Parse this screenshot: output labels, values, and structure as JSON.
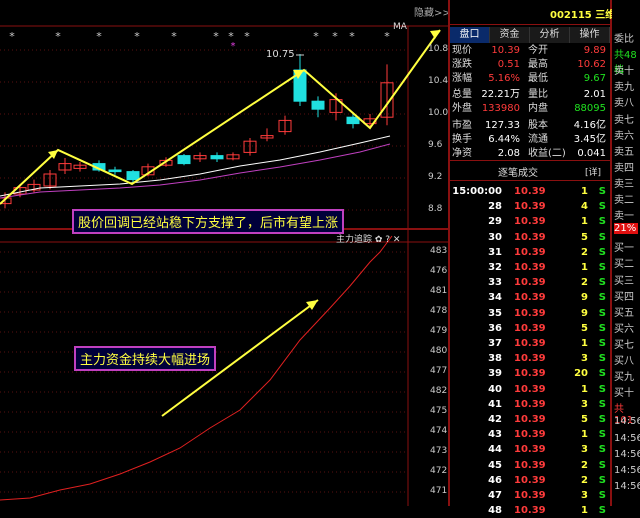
{
  "chart": {
    "hide_label": "隐藏>>",
    "peak_label": "10.75",
    "ma_label": "MA",
    "stars": [
      "*",
      "*",
      "*",
      "*",
      "*",
      "*",
      "*",
      "*",
      "*",
      "*",
      "*"
    ],
    "price_axis": [
      "10.8",
      "10.4",
      "10.0",
      "9.6",
      "9.2",
      "8.8"
    ],
    "annotation_price": "股价回调已经站稳下方支撑了，后市有望上涨",
    "indicator_title": "主力追踪 ✿ ? ✕",
    "annotation_flow": "主力资金持续大幅进场",
    "flow_axis": [
      "483",
      "481",
      "479",
      "477",
      "475",
      "473",
      "471",
      "470",
      "469",
      "476",
      "478",
      "480",
      "482",
      "474",
      "472"
    ],
    "colors": {
      "up": "#ff3b3b",
      "down": "#20e0e0",
      "arrow": "#ffff40",
      "border": "#c040c0",
      "ma_white": "#ffffff",
      "ma_purple": "#c040c0"
    }
  },
  "panel": {
    "code": "002115 三维通信",
    "tabs": [
      "盘口",
      "资金",
      "分析",
      "操作"
    ],
    "quote": [
      {
        "l1": "现价",
        "v1": "10.39",
        "l2": "今开",
        "v2": "9.89"
      },
      {
        "l1": "涨跌",
        "v1": "0.51",
        "l2": "最高",
        "v2": "10.62"
      },
      {
        "l1": "涨幅",
        "v1": "5.16%",
        "l2": "最低",
        "v2": "9.67"
      },
      {
        "l1": "总量",
        "v1": "22.21万",
        "l2": "量比",
        "v2": "2.01"
      },
      {
        "l1": "外盘",
        "v1": "133980",
        "l2": "内盘",
        "v2": "88095"
      },
      {
        "l1": "市盈",
        "v1": "127.33",
        "l2": "股本",
        "v2": "4.16亿"
      },
      {
        "l1": "换手",
        "v1": "6.44%",
        "l2": "流通",
        "v2": "3.45亿"
      },
      {
        "l1": "净资",
        "v1": "2.08",
        "l2": "收益(二)",
        "v2": "0.041"
      }
    ],
    "ticks_title": "逐笔成交",
    "ticks_detail": "[详]",
    "ticks": [
      {
        "t": "15:00:00",
        "p": "10.39",
        "v": "1",
        "s": "S"
      },
      {
        "t": "28",
        "p": "10.39",
        "v": "4",
        "s": "S"
      },
      {
        "t": "29",
        "p": "10.39",
        "v": "1",
        "s": "S"
      },
      {
        "t": "30",
        "p": "10.39",
        "v": "5",
        "s": "S"
      },
      {
        "t": "31",
        "p": "10.39",
        "v": "2",
        "s": "S"
      },
      {
        "t": "32",
        "p": "10.39",
        "v": "1",
        "s": "S"
      },
      {
        "t": "33",
        "p": "10.39",
        "v": "2",
        "s": "S"
      },
      {
        "t": "34",
        "p": "10.39",
        "v": "9",
        "s": "S"
      },
      {
        "t": "35",
        "p": "10.39",
        "v": "9",
        "s": "S"
      },
      {
        "t": "36",
        "p": "10.39",
        "v": "5",
        "s": "S"
      },
      {
        "t": "37",
        "p": "10.39",
        "v": "1",
        "s": "S"
      },
      {
        "t": "38",
        "p": "10.39",
        "v": "3",
        "s": "S"
      },
      {
        "t": "39",
        "p": "10.39",
        "v": "20",
        "s": "S"
      },
      {
        "t": "40",
        "p": "10.39",
        "v": "1",
        "s": "S"
      },
      {
        "t": "41",
        "p": "10.39",
        "v": "3",
        "s": "S"
      },
      {
        "t": "42",
        "p": "10.39",
        "v": "5",
        "s": "S"
      },
      {
        "t": "43",
        "p": "10.39",
        "v": "1",
        "s": "S"
      },
      {
        "t": "44",
        "p": "10.39",
        "v": "3",
        "s": "S"
      },
      {
        "t": "45",
        "p": "10.39",
        "v": "2",
        "s": "S"
      },
      {
        "t": "46",
        "p": "10.39",
        "v": "2",
        "s": "S"
      },
      {
        "t": "47",
        "p": "10.39",
        "v": "3",
        "s": "S"
      },
      {
        "t": "48",
        "p": "10.39",
        "v": "1",
        "s": "S"
      }
    ]
  },
  "rpanel": {
    "items": [
      "委比",
      "共48档",
      "卖十",
      "卖九",
      "卖八",
      "卖七",
      "卖六",
      "卖五",
      "卖四",
      "卖三",
      "卖二",
      "卖一",
      "21%",
      "买一",
      "买二",
      "买三",
      "买四",
      "买五",
      "买六",
      "买七",
      "买八",
      "买九",
      "买十",
      "共101",
      "14:56",
      "14:56",
      "14:56",
      "14:56",
      "14:56"
    ]
  }
}
